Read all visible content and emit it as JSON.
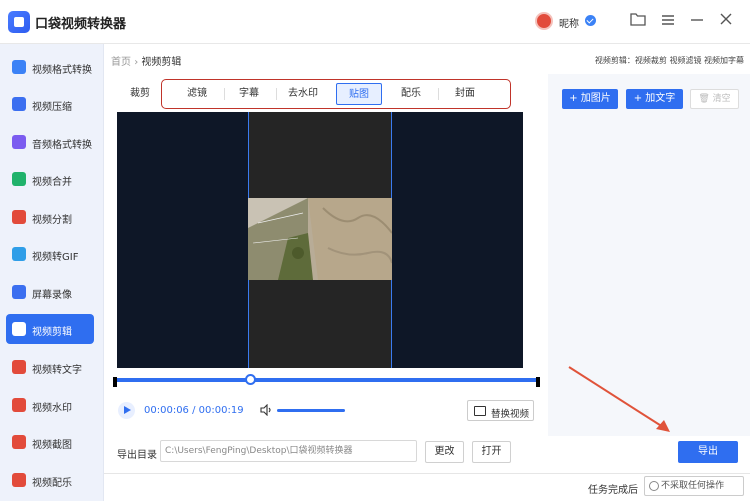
{
  "app": {
    "title": "口袋视频转换器",
    "user_name": "昵称"
  },
  "sidebar": {
    "items": [
      {
        "label": "视频格式转换",
        "icon": "video-format-icon",
        "color": "#3b82f6"
      },
      {
        "label": "视频压缩",
        "icon": "compress-icon",
        "color": "#3b6ff0"
      },
      {
        "label": "音频格式转换",
        "icon": "audio-icon",
        "color": "#7b5cf0"
      },
      {
        "label": "视频合并",
        "icon": "merge-icon",
        "color": "#20b26b"
      },
      {
        "label": "视频分割",
        "icon": "split-icon",
        "color": "#e24b3b"
      },
      {
        "label": "视频转GIF",
        "icon": "gif-icon",
        "color": "#2f9ee8"
      },
      {
        "label": "屏幕录像",
        "icon": "record-icon",
        "color": "#3b6ff0"
      },
      {
        "label": "视频剪辑",
        "icon": "edit-icon",
        "color": "#ffffff",
        "active": true
      },
      {
        "label": "视频转文字",
        "icon": "text-icon",
        "color": "#e24b3b"
      },
      {
        "label": "视频水印",
        "icon": "watermark-icon",
        "color": "#e24b3b"
      },
      {
        "label": "视频截图",
        "icon": "screenshot-icon",
        "color": "#e24b3b"
      },
      {
        "label": "视频配乐",
        "icon": "music-icon",
        "color": "#e24b3b"
      }
    ]
  },
  "breadcrumb": {
    "home": "首页",
    "sep": "›",
    "current": "视频剪辑"
  },
  "top_links": "视频剪辑：视频裁剪 视频滤镜 视频加字幕",
  "tabs": {
    "first": "裁剪",
    "items": [
      "滤镜",
      "字幕",
      "去水印",
      "贴图",
      "配乐",
      "封面"
    ],
    "selected": "贴图"
  },
  "player": {
    "progress": 0.32,
    "time_current": "00:00:06",
    "time_sep": " / ",
    "time_total": "00:00:19",
    "replace_label": "替换视频"
  },
  "right_panel": {
    "add_image": "+ 加图片",
    "add_text": "+ 加文字",
    "clear": "清空"
  },
  "output": {
    "label": "导出目录",
    "path": "C:\\Users\\FengPing\\Desktop\\口袋视频转换器",
    "change": "更改",
    "open": "打开",
    "export": "导出"
  },
  "status": {
    "after_done_label": "任务完成后",
    "after_done_value": "不采取任何操作"
  },
  "colors": {
    "accent": "#2f6ef0",
    "tab_outline": "#c0342a",
    "arrow": "#e0533a"
  }
}
